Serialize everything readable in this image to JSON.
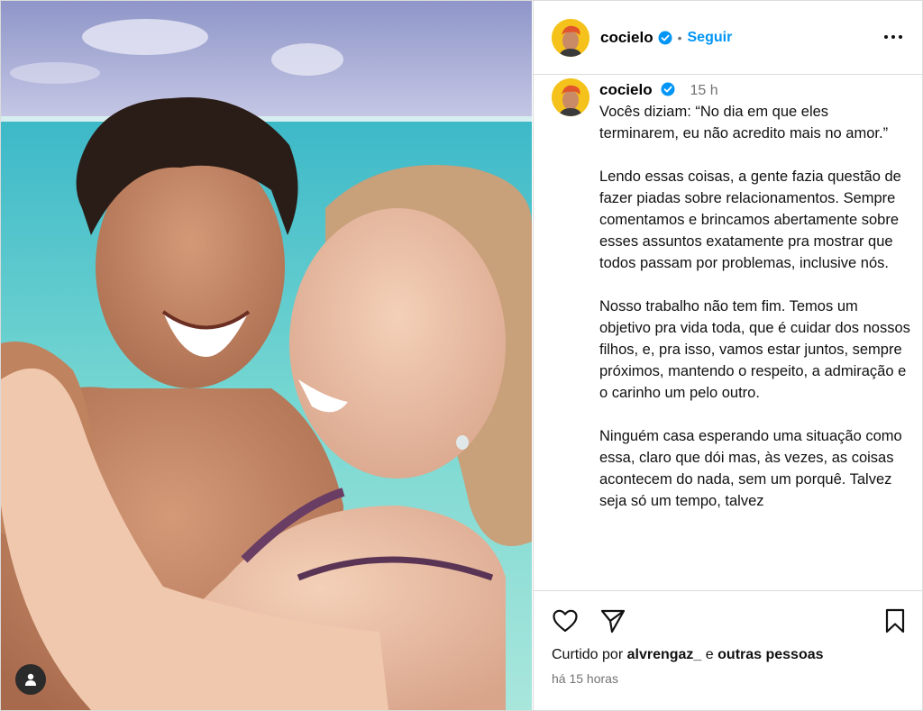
{
  "post": {
    "username": "cocielo",
    "separator": "•",
    "follow_label": "Seguir",
    "time_short": "15 h",
    "caption": "Vocês diziam: “No dia em que eles terminarem, eu não acredito mais no amor.”\n\nLendo essas coisas, a gente fazia questão de fazer piadas sobre relacionamentos. Sempre comentamos e brincamos abertamente sobre esses assuntos exatamente pra mostrar que todos passam por problemas, inclusive nós.\n\nNosso trabalho não tem fim. Temos um objetivo pra vida toda, que é cuidar dos nossos filhos, e, pra isso, vamos estar juntos, sempre próximos, mantendo o respeito, a admiração e o carinho um pelo outro.\n\nNinguém casa esperando uma situação como essa, claro que dói mas, às vezes, as coisas acontecem do nada, sem um porquê. Talvez seja só um tempo, talvez",
    "liked_prefix": "Curtido por",
    "liked_user": "alvrengaz_",
    "liked_and": "e",
    "liked_others": "outras pessoas",
    "time_long": "há 15 horas"
  },
  "icons": {
    "verified": "verified-badge-icon",
    "more": "more-options-icon",
    "like": "heart-icon",
    "share": "send-icon",
    "save": "bookmark-icon",
    "tags": "user-tag-icon"
  },
  "colors": {
    "accent": "#0095f6",
    "verified": "#0095f6",
    "muted": "#737373"
  }
}
